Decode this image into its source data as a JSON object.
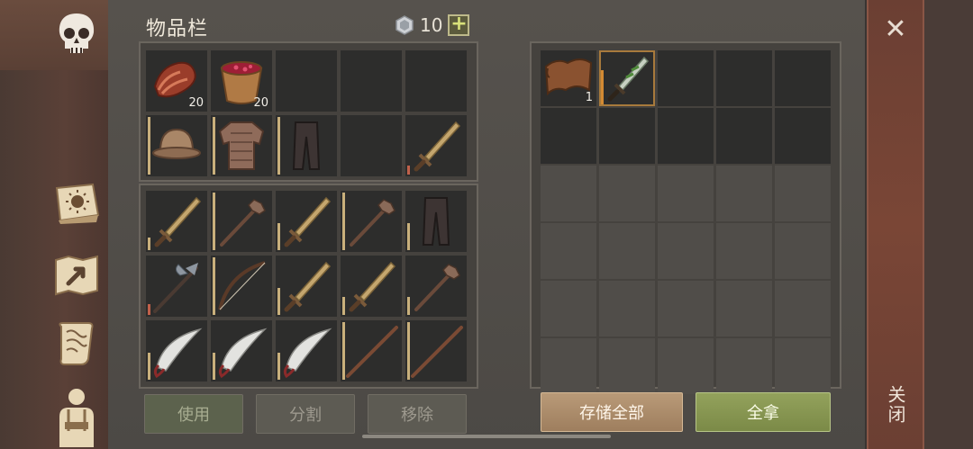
{
  "header": {
    "title": "物品栏",
    "currency_value": "10",
    "plus_label": "+"
  },
  "sidebar": {
    "items": [
      {
        "name": "skull"
      },
      {
        "name": "sun-book"
      },
      {
        "name": "map"
      },
      {
        "name": "scroll"
      },
      {
        "name": "character"
      }
    ]
  },
  "inventory": {
    "equip_row1": [
      {
        "item": "meat",
        "qty": "20"
      },
      {
        "item": "berry-bucket",
        "qty": "20"
      },
      {
        "item": "",
        "qty": ""
      },
      {
        "item": "",
        "qty": ""
      },
      {
        "item": "",
        "qty": ""
      }
    ],
    "equip_row2": [
      {
        "item": "helmet"
      },
      {
        "item": "chainmail"
      },
      {
        "item": "pants"
      },
      {
        "item": ""
      },
      {
        "item": "sword"
      }
    ],
    "rows": [
      [
        "sword",
        "mace",
        "sword",
        "mace",
        "pants"
      ],
      [
        "halberd",
        "bow",
        "sword",
        "sword",
        "mace"
      ],
      [
        "scimitar",
        "scimitar",
        "scimitar",
        "staff",
        "staff"
      ]
    ]
  },
  "storage": {
    "items": [
      {
        "item": "leather",
        "qty": "1"
      },
      {
        "item": "poison-dagger",
        "qty": ""
      }
    ]
  },
  "buttons": {
    "use": "使用",
    "split": "分割",
    "remove": "移除",
    "store_all": "存储全部",
    "take_all": "全拿"
  },
  "close": {
    "label": "关闭"
  },
  "colors": {
    "durability_high": "#c9b07c",
    "durability_low": "#c0604a",
    "accent_orange": "#d38a33"
  }
}
